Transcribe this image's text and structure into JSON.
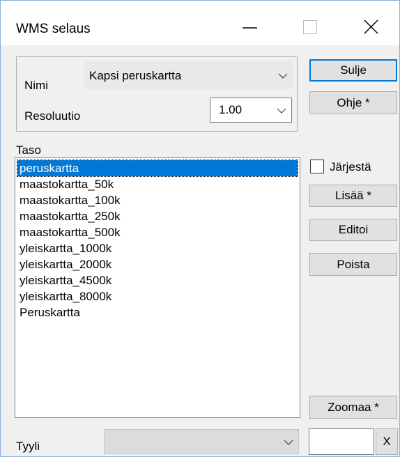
{
  "window": {
    "title": "WMS selaus"
  },
  "settings": {
    "nimi_label": "Nimi",
    "nimi_value": "Kapsi peruskartta",
    "resoluutio_label": "Resoluutio",
    "resoluutio_value": "1.00"
  },
  "buttons": {
    "sulje": "Sulje",
    "ohje": "Ohje *",
    "lisaa": "Lisää *",
    "editoi": "Editoi",
    "poista": "Poista",
    "zoomaa": "Zoomaa *",
    "x": "X"
  },
  "taso": {
    "label": "Taso",
    "items": [
      "peruskartta",
      "maastokartta_50k",
      "maastokartta_100k",
      "maastokartta_250k",
      "maastokartta_500k",
      "yleiskartta_1000k",
      "yleiskartta_2000k",
      "yleiskartta_4500k",
      "yleiskartta_8000k",
      "Peruskartta"
    ],
    "selected_index": 0
  },
  "jarjesta": {
    "label": "Järjestä",
    "checked": false
  },
  "tyyli": {
    "label": "Tyyli",
    "value": ""
  },
  "colors": {
    "selection": "#0078d7",
    "focus_border": "#0078d7"
  },
  "icons": {
    "minimize": "minimize-icon",
    "maximize": "maximize-icon",
    "close": "close-icon",
    "dropdown": "chevron-down-icon"
  }
}
